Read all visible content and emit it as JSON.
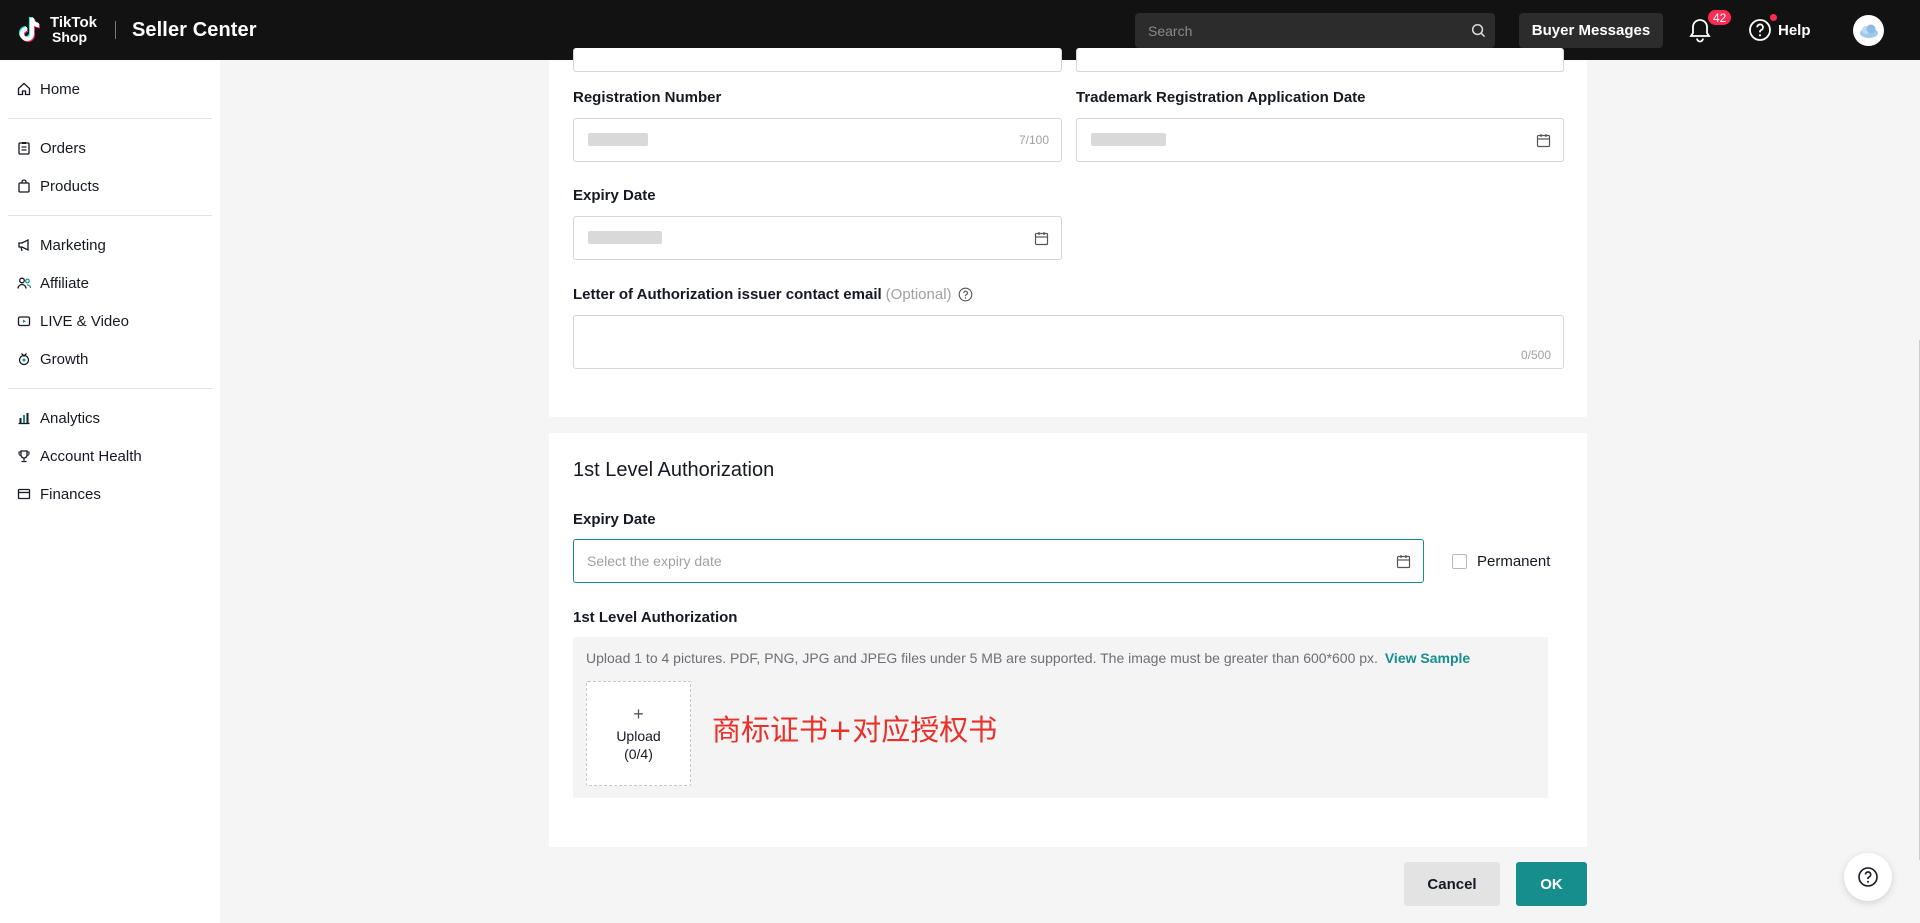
{
  "header": {
    "logo_line1": "TikTok",
    "logo_line2": "Shop",
    "app_title": "Seller Center",
    "search_placeholder": "Search",
    "buyer_messages_label": "Buyer Messages",
    "notification_count": "42",
    "help_label": "Help"
  },
  "sidebar": {
    "groups": [
      [
        {
          "label": "Home",
          "icon": "home-icon"
        }
      ],
      [
        {
          "label": "Orders",
          "icon": "orders-icon"
        },
        {
          "label": "Products",
          "icon": "products-icon"
        }
      ],
      [
        {
          "label": "Marketing",
          "icon": "megaphone-icon"
        },
        {
          "label": "Affiliate",
          "icon": "affiliate-icon"
        },
        {
          "label": "LIVE & Video",
          "icon": "video-icon"
        },
        {
          "label": "Growth",
          "icon": "growth-icon"
        }
      ],
      [
        {
          "label": "Analytics",
          "icon": "analytics-icon"
        },
        {
          "label": "Account Health",
          "icon": "trophy-icon"
        },
        {
          "label": "Finances",
          "icon": "finances-icon"
        }
      ]
    ]
  },
  "trademark": {
    "registration_number_label": "Registration Number",
    "registration_number_counter": "7/100",
    "application_date_label": "Trademark Registration Application Date",
    "expiry_date_label": "Expiry Date",
    "loa_email_label": "Letter of Authorization issuer contact email",
    "loa_email_optional": "(Optional)",
    "loa_email_counter": "0/500"
  },
  "authorization": {
    "section_title": "1st Level Authorization",
    "expiry_date_label": "Expiry Date",
    "expiry_date_placeholder": "Select the expiry date",
    "permanent_label": "Permanent",
    "upload_label": "1st Level Authorization",
    "upload_hint": "Upload 1 to 4 pictures. PDF, PNG, JPG and JPEG files under 5 MB are supported. The image must be greater than 600*600 px.",
    "view_sample_label": "View Sample",
    "upload_button_line1": "Upload",
    "upload_button_line2": "(0/4)",
    "annotation_text": "商标证书+对应授权书"
  },
  "footer": {
    "cancel_label": "Cancel",
    "ok_label": "OK"
  },
  "colors": {
    "accent": "#168e8e",
    "badge": "#fe2c55",
    "annotation": "#e8312b"
  }
}
